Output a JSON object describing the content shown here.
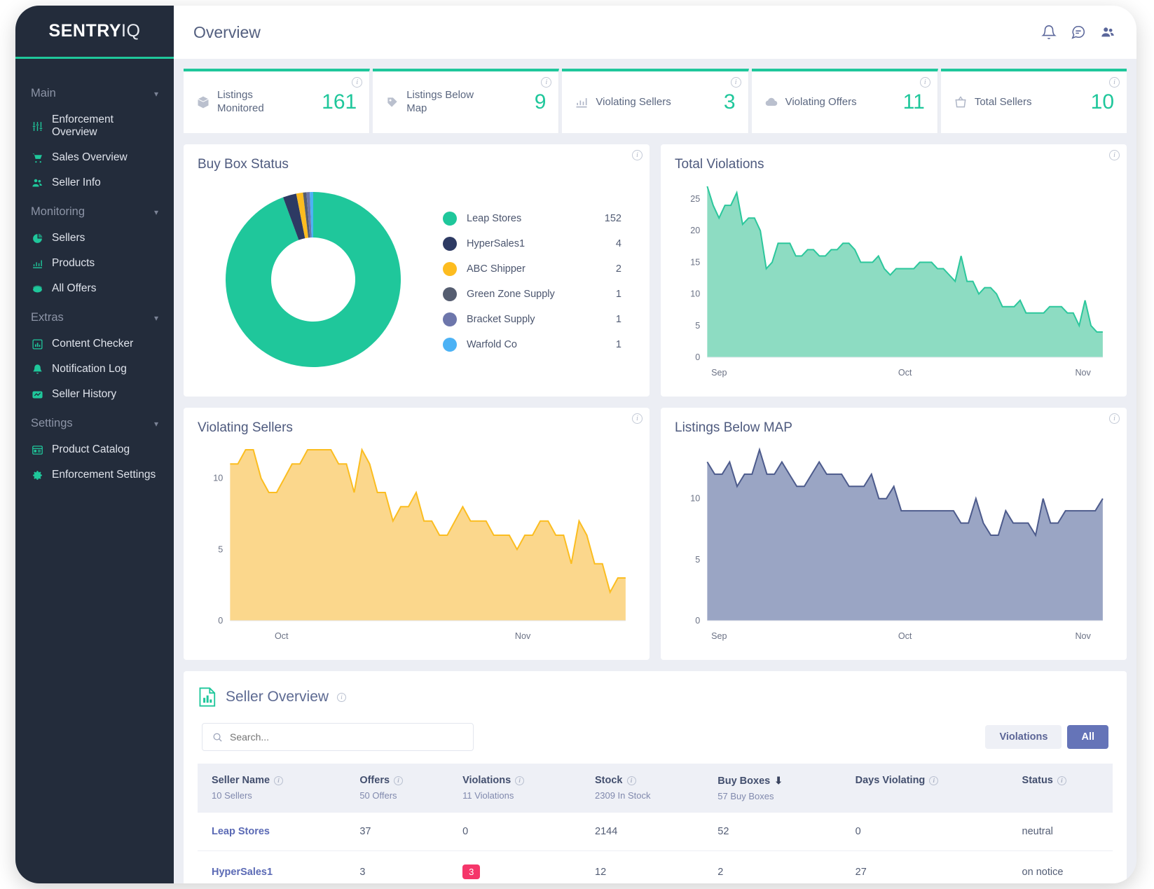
{
  "brand": {
    "part1": "SENTRY",
    "part2": "IQ"
  },
  "sidebar": {
    "groups": [
      {
        "label": "Main",
        "items": [
          {
            "label": "Enforcement Overview",
            "icon": "sliders-icon"
          },
          {
            "label": "Sales Overview",
            "icon": "cart-icon"
          },
          {
            "label": "Seller Info",
            "icon": "users-icon"
          }
        ]
      },
      {
        "label": "Monitoring",
        "items": [
          {
            "label": "Sellers",
            "icon": "pie-icon"
          },
          {
            "label": "Products",
            "icon": "chart-up-icon"
          },
          {
            "label": "All Offers",
            "icon": "offers-icon"
          }
        ]
      },
      {
        "label": "Extras",
        "items": [
          {
            "label": "Content Checker",
            "icon": "document-chart-icon"
          },
          {
            "label": "Notification Log",
            "icon": "bell-icon"
          },
          {
            "label": "Seller History",
            "icon": "history-icon"
          }
        ]
      },
      {
        "label": "Settings",
        "items": [
          {
            "label": "Product Catalog",
            "icon": "catalog-icon"
          },
          {
            "label": "Enforcement Settings",
            "icon": "gear-icon"
          }
        ]
      }
    ]
  },
  "topbar": {
    "title": "Overview",
    "icons": [
      "bell-icon",
      "chat-icon",
      "avatar-icon"
    ]
  },
  "kpis": [
    {
      "label": "Listings Monitored",
      "value": "161",
      "icon": "box-icon"
    },
    {
      "label": "Listings Below Map",
      "value": "9",
      "icon": "tag-icon"
    },
    {
      "label": "Violating Sellers",
      "value": "3",
      "icon": "chart-up-icon"
    },
    {
      "label": "Violating Offers",
      "value": "11",
      "icon": "cloud-icon"
    },
    {
      "label": "Total Sellers",
      "value": "10",
      "icon": "basket-icon"
    }
  ],
  "cards": {
    "buy_box": {
      "title": "Buy Box Status"
    },
    "total_violations": {
      "title": "Total Violations"
    },
    "violating_sellers": {
      "title": "Violating Sellers"
    },
    "listings_below_map": {
      "title": "Listings Below MAP"
    }
  },
  "seller_overview": {
    "title": "Seller Overview",
    "search_placeholder": "Search...",
    "search_value": "",
    "filter_violations": "Violations",
    "filter_all": "All",
    "columns": [
      {
        "label": "Seller Name",
        "sub": "10 Sellers",
        "sorted": false
      },
      {
        "label": "Offers",
        "sub": "50 Offers",
        "sorted": false
      },
      {
        "label": "Violations",
        "sub": "11 Violations",
        "sorted": false
      },
      {
        "label": "Stock",
        "sub": "2309 In Stock",
        "sorted": false
      },
      {
        "label": "Buy Boxes",
        "sub": "57 Buy Boxes",
        "sorted": true
      },
      {
        "label": "Days Violating",
        "sub": "",
        "sorted": false
      },
      {
        "label": "Status",
        "sub": "",
        "sorted": false
      }
    ],
    "rows": [
      {
        "name": "Leap Stores",
        "offers": "37",
        "violations": "0",
        "violations_badge": false,
        "stock": "2144",
        "buy_boxes": "52",
        "days_violating": "0",
        "status": "neutral"
      },
      {
        "name": "HyperSales1",
        "offers": "3",
        "violations": "3",
        "violations_badge": true,
        "stock": "12",
        "buy_boxes": "2",
        "days_violating": "27",
        "status": "on notice"
      }
    ]
  },
  "colors": {
    "accent_green": "#1fc79b",
    "navy": "#2d3a63",
    "yellow": "#fdbc1f",
    "slate": "#555d70",
    "periwinkle": "#6d76ab",
    "sky": "#4cb2f5",
    "area_green_fill": "#8ddcc2",
    "area_green_line": "#2cc79c",
    "area_yellow_fill": "#fbd78c",
    "area_yellow_line": "#fbbd20",
    "area_blue_fill": "#9aa5c4",
    "area_blue_line": "#4d5b8c",
    "badge_pink": "#f5366a",
    "toggle_active": "#6574b8"
  },
  "chart_data": [
    {
      "type": "pie",
      "title": "Buy Box Status",
      "legend_position": "right",
      "labels": [
        "Leap Stores",
        "HyperSales1",
        "ABC Shipper",
        "Green Zone Supply",
        "Bracket Supply",
        "Warfold Co"
      ],
      "values": [
        152,
        4,
        2,
        1,
        1,
        1
      ],
      "colors": [
        "#1fc79b",
        "#2d3a63",
        "#fdbc1f",
        "#555d70",
        "#6d76ab",
        "#4cb2f5"
      ]
    },
    {
      "type": "area",
      "title": "Total Violations",
      "xlabel": "",
      "ylabel": "",
      "ylim": [
        0,
        27
      ],
      "yticks": [
        0,
        5,
        10,
        15,
        20,
        25
      ],
      "xticks": [
        "Sep",
        "Oct",
        "Nov"
      ],
      "grid": false,
      "color": "#2cc79c",
      "fill": "#8ddcc2",
      "values": [
        27,
        24,
        22,
        24,
        24,
        26,
        21,
        22,
        22,
        20,
        14,
        15,
        18,
        18,
        18,
        16,
        16,
        17,
        17,
        16,
        16,
        17,
        17,
        18,
        18,
        17,
        15,
        15,
        15,
        16,
        14,
        13,
        14,
        14,
        14,
        14,
        15,
        15,
        15,
        14,
        14,
        13,
        12,
        16,
        12,
        12,
        10,
        11,
        11,
        10,
        8,
        8,
        8,
        9,
        7,
        7,
        7,
        7,
        8,
        8,
        8,
        7,
        7,
        5,
        9,
        5,
        4,
        4
      ]
    },
    {
      "type": "area",
      "title": "Violating Sellers",
      "xlabel": "",
      "ylabel": "",
      "ylim": [
        0,
        12
      ],
      "yticks": [
        0,
        5,
        10
      ],
      "xticks": [
        "Oct",
        "Nov"
      ],
      "grid": false,
      "color": "#fbbd20",
      "fill": "#fbd78c",
      "values": [
        11,
        11,
        12,
        12,
        10,
        9,
        9,
        10,
        11,
        11,
        12,
        12,
        12,
        12,
        11,
        11,
        9,
        12,
        11,
        9,
        9,
        7,
        8,
        8,
        9,
        7,
        7,
        6,
        6,
        7,
        8,
        7,
        7,
        7,
        6,
        6,
        6,
        5,
        6,
        6,
        7,
        7,
        6,
        6,
        4,
        7,
        6,
        4,
        4,
        2,
        3,
        3
      ]
    },
    {
      "type": "area",
      "title": "Listings Below MAP",
      "xlabel": "",
      "ylabel": "",
      "ylim": [
        0,
        14
      ],
      "yticks": [
        0,
        5,
        10
      ],
      "xticks": [
        "Sep",
        "Oct",
        "Nov"
      ],
      "grid": false,
      "color": "#4d5b8c",
      "fill": "#9aa5c4",
      "values": [
        13,
        12,
        12,
        13,
        11,
        12,
        12,
        14,
        12,
        12,
        13,
        12,
        11,
        11,
        12,
        13,
        12,
        12,
        12,
        11,
        11,
        11,
        12,
        10,
        10,
        11,
        9,
        9,
        9,
        9,
        9,
        9,
        9,
        9,
        8,
        8,
        10,
        8,
        7,
        7,
        9,
        8,
        8,
        8,
        7,
        10,
        8,
        8,
        9,
        9,
        9,
        9,
        9,
        10
      ]
    }
  ]
}
